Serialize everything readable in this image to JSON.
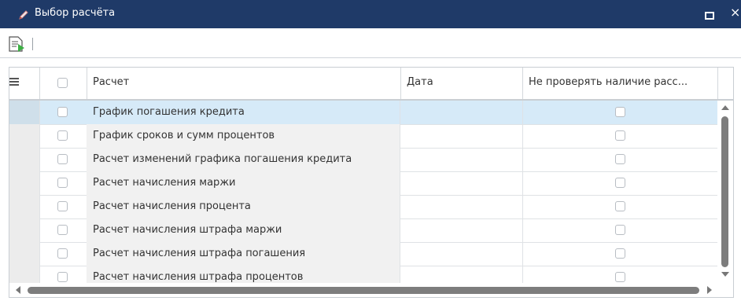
{
  "window": {
    "title": "Выбор расчёта",
    "title_icon": "pencil-icon",
    "controls": [
      "maximize-icon",
      "close-icon"
    ],
    "close_glyph": "×",
    "titlebar_color": "#1f3a68"
  },
  "toolbar": {
    "buttons": [
      {
        "icon": "document-run-icon"
      }
    ]
  },
  "grid": {
    "columns": [
      {
        "key": "menu",
        "label": ""
      },
      {
        "key": "select",
        "label": ""
      },
      {
        "key": "name",
        "label": "Расчет"
      },
      {
        "key": "date",
        "label": "Дата"
      },
      {
        "key": "no_check",
        "label": "Не проверять наличие расс..."
      }
    ],
    "selected_row": 0,
    "selected_color": "#d6eaf8",
    "rows": [
      {
        "name": "График погашения кредита",
        "date": "",
        "checked": false,
        "no_check": false
      },
      {
        "name": "График сроков и сумм процентов",
        "date": "",
        "checked": false,
        "no_check": false
      },
      {
        "name": "Расчет изменений графика погашения кредита",
        "date": "",
        "checked": false,
        "no_check": false
      },
      {
        "name": "Расчет начисления маржи",
        "date": "",
        "checked": false,
        "no_check": false
      },
      {
        "name": "Расчет начисления процента",
        "date": "",
        "checked": false,
        "no_check": false
      },
      {
        "name": "Расчет начисления штрафа маржи",
        "date": "",
        "checked": false,
        "no_check": false
      },
      {
        "name": "Расчет начисления штрафа погашения",
        "date": "",
        "checked": false,
        "no_check": false
      },
      {
        "name": "Расчет начисления штрафа процентов",
        "date": "",
        "checked": false,
        "no_check": false
      }
    ]
  }
}
